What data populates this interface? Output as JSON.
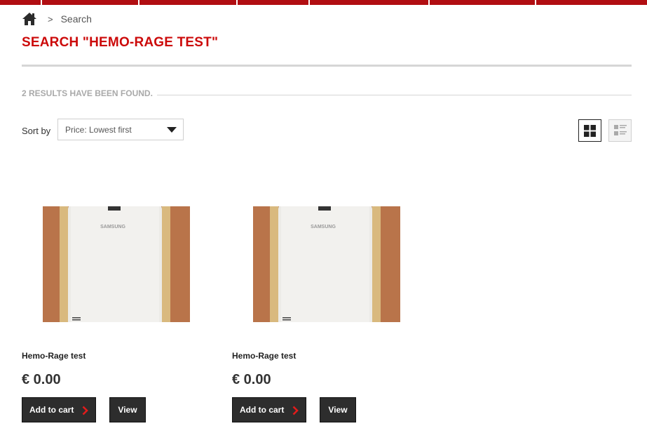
{
  "colors": {
    "accent": "#cc0a0a",
    "topbar": "#b10e12",
    "button_bg": "#2d2d2d"
  },
  "breadcrumb": {
    "home_icon": "home-icon",
    "separator": ">",
    "current": "Search"
  },
  "page": {
    "title": "SEARCH \"HEMO-RAGE TEST\"",
    "results_count": "2 results have been found."
  },
  "sort": {
    "label": "Sort by",
    "selected": "Price: Lowest first"
  },
  "view_toggle": {
    "grid_icon": "grid-view-icon",
    "list_icon": "list-view-icon",
    "active": "grid"
  },
  "products": [
    {
      "name": "Hemo-Rage test",
      "price": "€ 0.00",
      "image_text": "SAMSUNG",
      "add_to_cart_label": "Add to cart",
      "view_label": "View"
    },
    {
      "name": "Hemo-Rage test",
      "price": "€ 0.00",
      "image_text": "SAMSUNG",
      "add_to_cart_label": "Add to cart",
      "view_label": "View"
    }
  ]
}
